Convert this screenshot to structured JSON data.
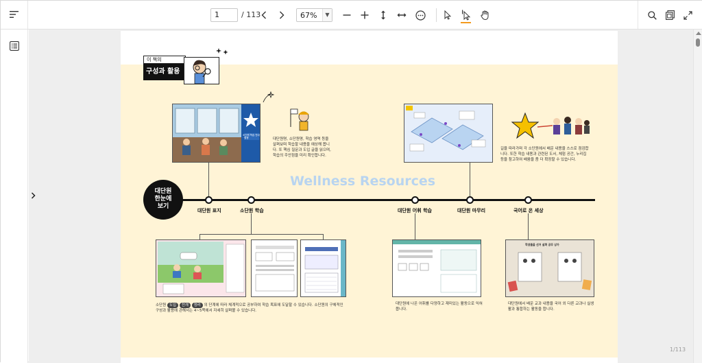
{
  "toolbar": {
    "page_input_value": "1",
    "page_total": "/ 113",
    "zoom_value": "67%",
    "zoom_options": [
      "67%"
    ]
  },
  "viewer": {
    "page_indicator": "1/113"
  },
  "pdf_page": {
    "section_label": "이 책의",
    "section_title": "구성과 활용",
    "watermark": "Wellness Resources",
    "unit_circle_lines": [
      "대단원",
      "한눈에",
      "보기"
    ],
    "nodes": [
      {
        "label": "대단원 표지"
      },
      {
        "label": "소단원 학습"
      },
      {
        "label": "대단원 어휘 학습"
      },
      {
        "label": "대단원 마무리"
      },
      {
        "label": "국어로 온 세상"
      }
    ],
    "cover_thumb_text": "소단원 학습 안내 · 활동",
    "desc_top_left": "대단원명, 소단원명, 학습 영역 등을 살펴보며 학습할 내용을 예상해 봅니다. 또 핵심 질문과 도입 글을 읽으며, 학습의 주안점을 미리 확인합니다.",
    "desc_top_right": "길을 따라가며 각 소단원에서 배운 내용을 스스로 점검합니다. 또한 학습 내용과 관련된 도서, 체험 공간, 누리집 등을 참고하여 배움을 좀 더 확장할 수 있습니다.",
    "desc_bottom_left_prefix": "소단원",
    "desc_bottom_left_pills": [
      "도입",
      "전개",
      "정리"
    ],
    "desc_bottom_left_rest": "의 단계에 따라 체계적으로 공부하여 학습 목표에 도달할 수 있습니다. 소단원의 구체적인 구성과 활용에 관해서는 4~5쪽에서 자세히 살펴볼 수 있습니다.",
    "desc_bottom_mid": "대단원에 나온 어휘를 다양하고 재미있는 활동으로 익혀 봅니다.",
    "desc_bottom_right": "대단원에서 배운 교과 내용을 국어 외 다른 교과나 실생활과 통합하는 활동을 합니다.",
    "magazine_title": "학생들을 선거 살펴 공무 상가"
  },
  "colors": {
    "page_bg": "#fff4d6",
    "accent_underline": "#f39a1d",
    "watermark": "#b8d4f0"
  },
  "icons": [
    "menu-icon",
    "chevron-left-icon",
    "chevron-right-icon",
    "zoom-out-icon",
    "zoom-in-icon",
    "fit-height-icon",
    "fit-width-icon",
    "more-icon",
    "select-cursor-icon",
    "text-cursor-icon",
    "hand-icon",
    "search-icon",
    "thumbnails-icon",
    "fullscreen-icon",
    "outline-icon",
    "expand-chevron-icon"
  ]
}
